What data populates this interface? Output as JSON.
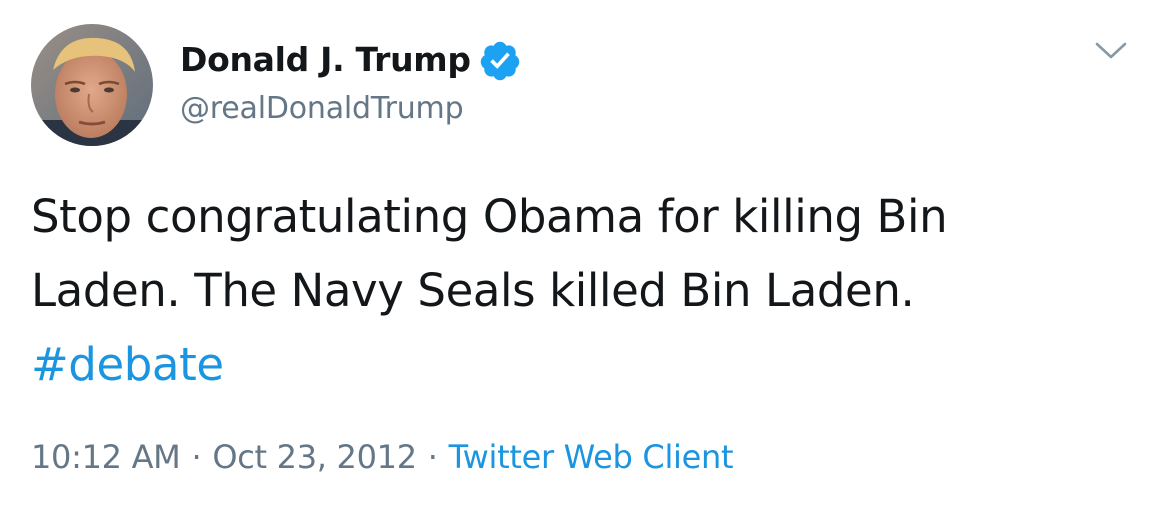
{
  "author": {
    "display_name": "Donald J. Trump",
    "handle": "@realDonaldTrump",
    "verified": true,
    "avatar_icon": "profile-photo"
  },
  "tweet": {
    "text_line_1": "Stop congratulating Obama for killing Bin",
    "text_line_2": "Laden. The Navy Seals killed Bin Laden.",
    "hashtag": "#debate"
  },
  "meta": {
    "time": "10:12 AM",
    "separator": "·",
    "date": "Oct 23, 2012",
    "source": "Twitter Web Client"
  },
  "icons": {
    "verified": "verified-badge-icon",
    "menu": "chevron-down-icon"
  },
  "colors": {
    "link": "#1b95e0",
    "secondary_text": "#657786",
    "primary_text": "#14171a",
    "verified_badge": "#1da1f2"
  }
}
